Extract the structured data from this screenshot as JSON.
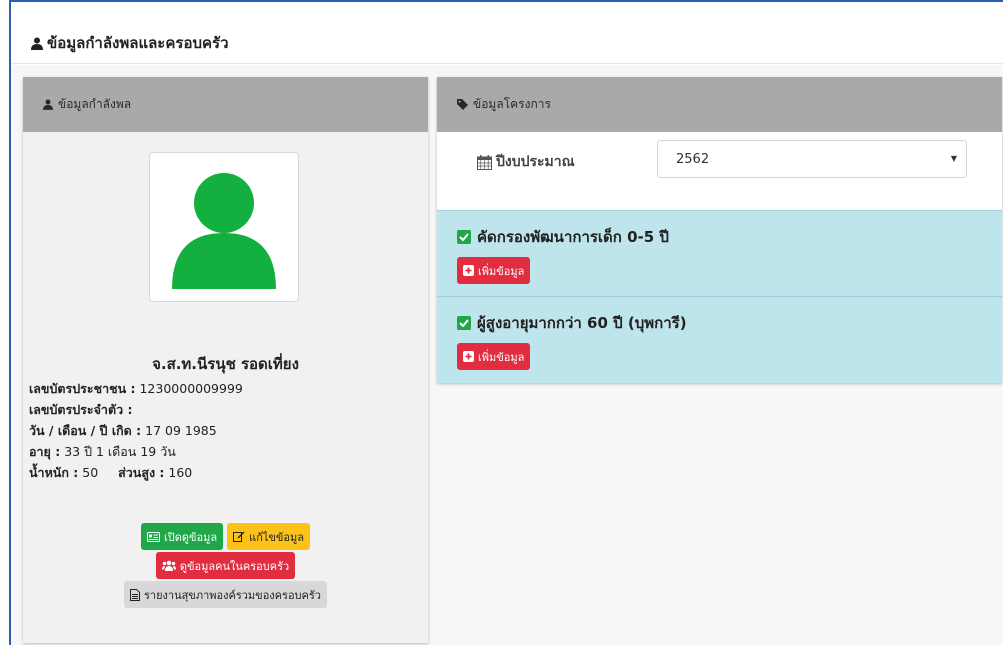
{
  "page": {
    "title": "ข้อมูลกำลังพลและครอบครัว"
  },
  "personnel": {
    "header": "ข้อมูลกำลังพล",
    "name": "จ.ส.ท.นีรนุช  รอดเที่ยง",
    "fields": [
      {
        "label": "เลขบัตรประชาชน :",
        "value": "1230000009999"
      },
      {
        "label": "เลขบัตรประจำตัว :",
        "value": ""
      },
      {
        "label": "วัน / เดือน / ปี เกิด :",
        "value": "17 09 1985"
      },
      {
        "label": "อายุ :",
        "value": "33 ปี 1 เดือน 19 วัน"
      }
    ],
    "weight_label": "น้ำหนัก :",
    "weight_value": "50",
    "height_label": "ส่วนสูง :",
    "height_value": "160",
    "buttons": {
      "view": "เปิดดูข้อมูล",
      "edit": "แก้ไขข้อมูล",
      "family": "ดูข้อมูลคนในครอบครัว",
      "report": "รายงานสุขภาพองค์รวมของครอบครัว"
    }
  },
  "project": {
    "header": "ข้อมูลโครงการ",
    "year_label": "ปีงบประมาณ",
    "year_value": "2562",
    "items": [
      {
        "title": "คัดกรองพัฒนาการเด็ก 0-5 ปี",
        "button": "เพิ่มข้อมูล"
      },
      {
        "title": "ผู้สูงอายุมากกว่า 60 ปี (บุพการี)",
        "button": "เพิ่มข้อมูล"
      }
    ]
  },
  "colors": {
    "avatar": "#14b03f",
    "header_bg": "#a8a9ab",
    "project_bg": "#bfe5ec",
    "frame": "#2f5fb0"
  },
  "icons": [
    "user-icon",
    "tag-icon",
    "calendar-icon",
    "check-square-icon",
    "plus-square-icon",
    "id-card-icon",
    "edit-icon",
    "users-icon",
    "file-icon"
  ]
}
